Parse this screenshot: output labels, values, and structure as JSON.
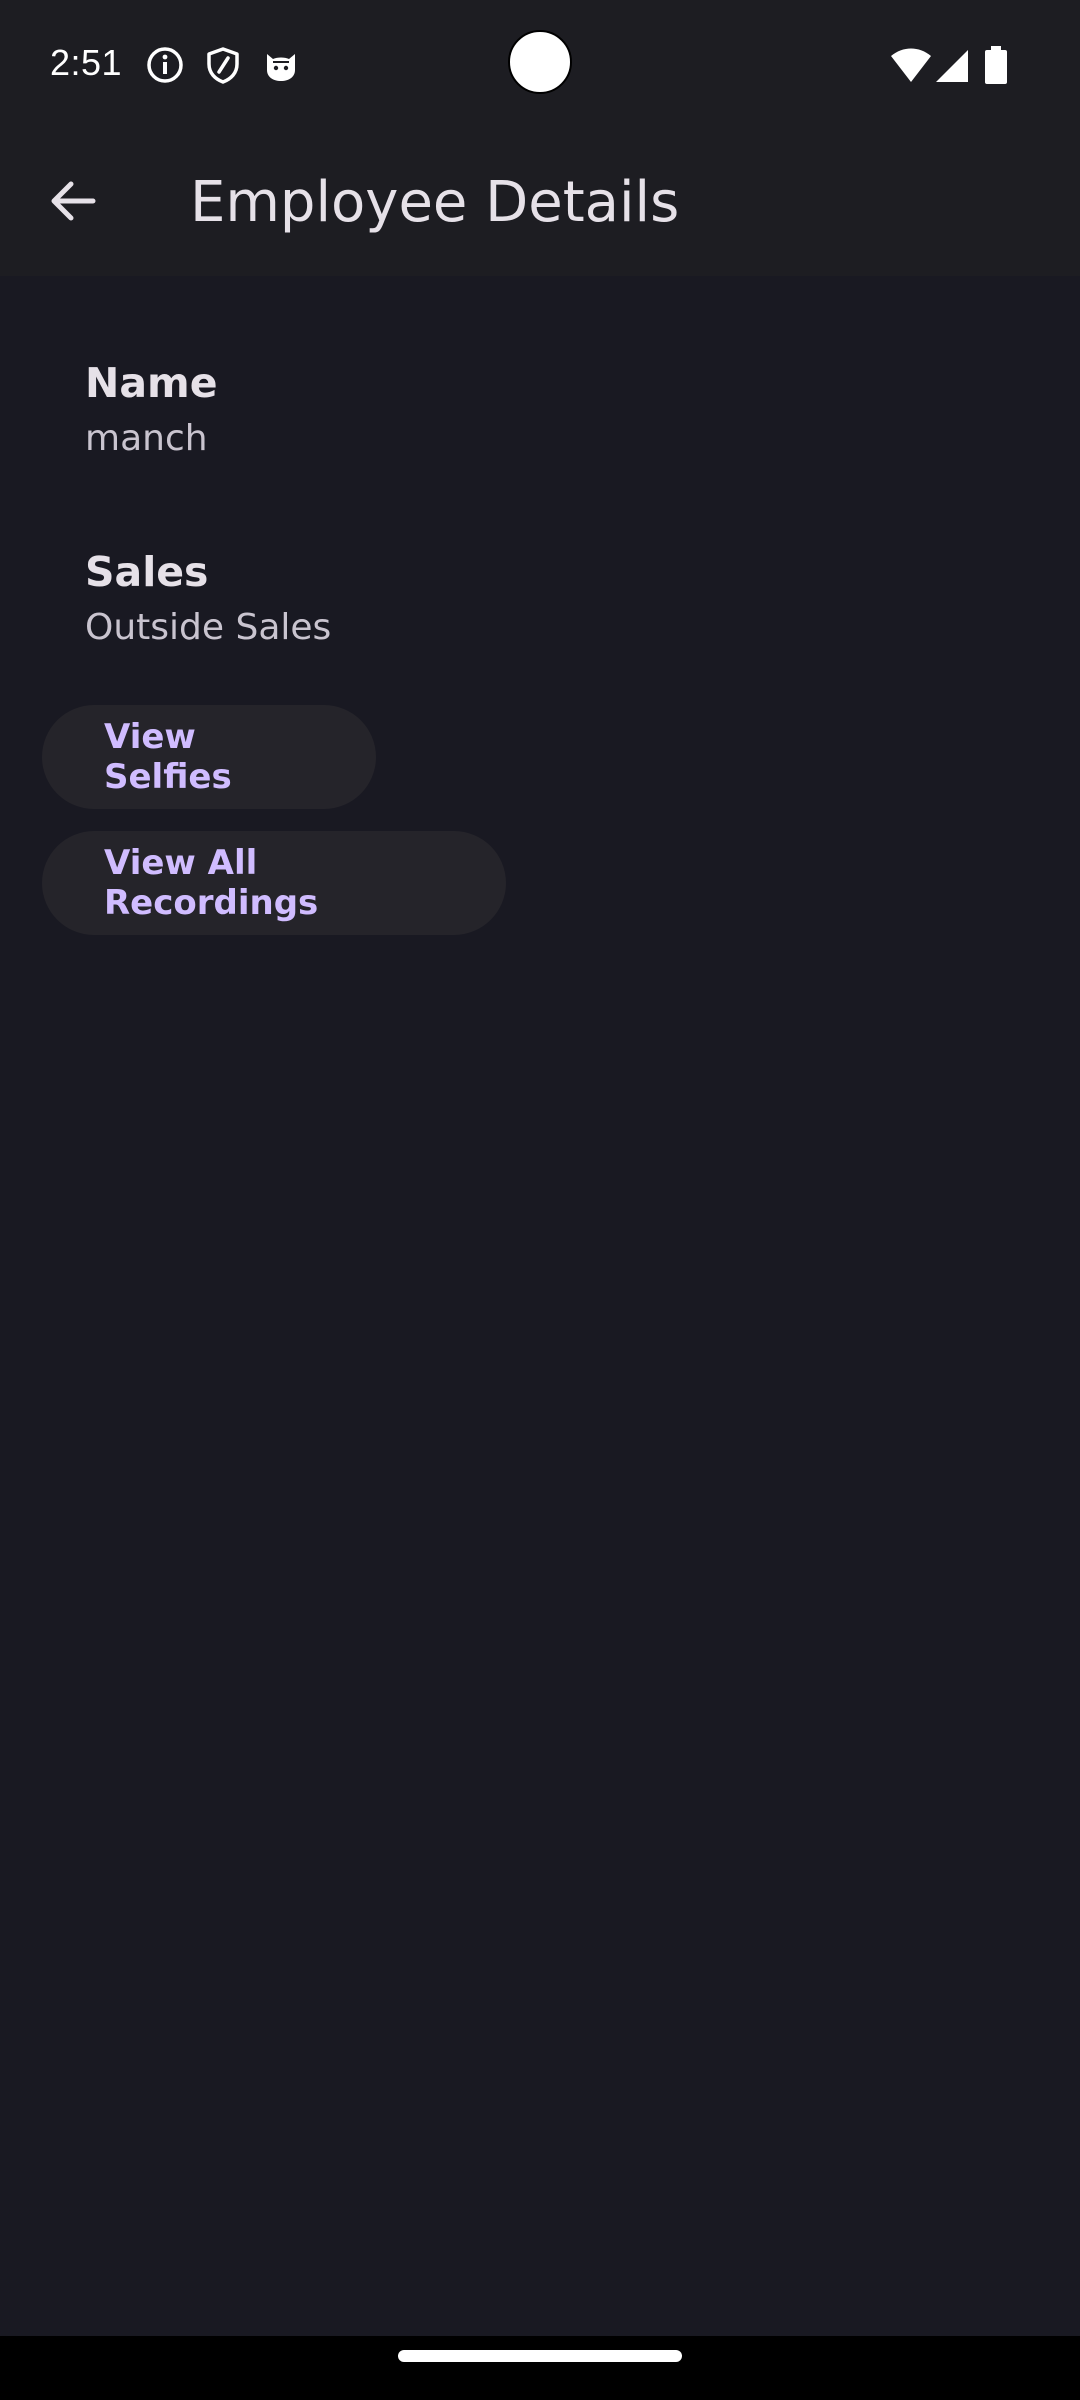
{
  "status_bar": {
    "time": "2:51",
    "left_icons": [
      "info-icon",
      "shield-icon",
      "cat-icon"
    ],
    "right_icons": [
      "wifi-icon",
      "signal-icon",
      "battery-icon"
    ]
  },
  "app_bar": {
    "back_icon": "arrow-left-icon",
    "title": "Employee Details"
  },
  "details": {
    "name_label": "Name",
    "name_value": "manch",
    "department_label": "Sales",
    "department_value": "Outside Sales"
  },
  "actions": {
    "view_selfies_label": "View Selfies",
    "view_recordings_label": "View All Recordings"
  },
  "colors": {
    "background": "#191922",
    "surface": "#1d1d22",
    "button_bg": "#25242a",
    "button_text": "#d0bcff",
    "text_primary": "#e6e1e8",
    "text_secondary": "#c9c4cf"
  }
}
